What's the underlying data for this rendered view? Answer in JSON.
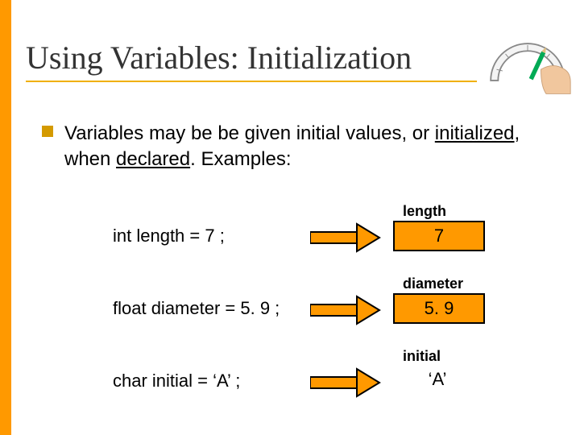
{
  "title": "Using Variables: Initialization",
  "paragraph": {
    "pre": "Variables may be be given initial values, or ",
    "underlined": "initialized",
    "mid": ", when ",
    "underlined2": "declared",
    "post": ".  Examples:"
  },
  "examples": [
    {
      "code": "int length = 7 ;",
      "label": "length",
      "value": "7",
      "box": true
    },
    {
      "code": "float diameter = 5. 9 ;",
      "label": "diameter",
      "value": "5. 9",
      "box": true
    },
    {
      "code": "char initial = ‘A’ ;",
      "label": "initial",
      "value": "‘A’",
      "box": false
    }
  ],
  "colors": {
    "accent": "#ff9900",
    "titleUnderline": "#f0b000",
    "bullet": "#d49a00"
  }
}
